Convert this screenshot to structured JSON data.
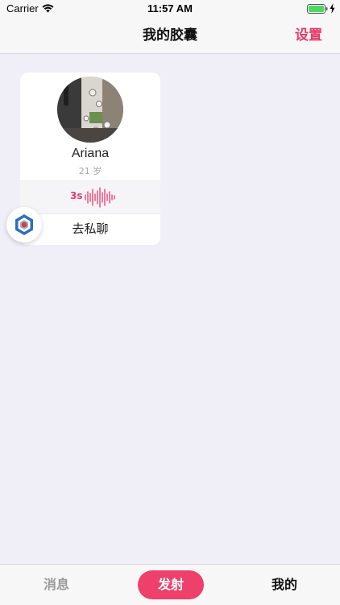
{
  "status_bar": {
    "carrier": "Carrier",
    "time": "11:57 AM"
  },
  "nav": {
    "title": "我的胶囊",
    "action_label": "设置"
  },
  "card": {
    "name": "Ariana",
    "age": "21 岁",
    "voice_duration": "3s",
    "chat_label": "去私聊"
  },
  "tabs": {
    "messages": "消息",
    "launch": "发射",
    "mine": "我的"
  },
  "colors": {
    "accent": "#e8396a",
    "launch_button": "#ef3f6b",
    "background": "#f0eff8"
  }
}
